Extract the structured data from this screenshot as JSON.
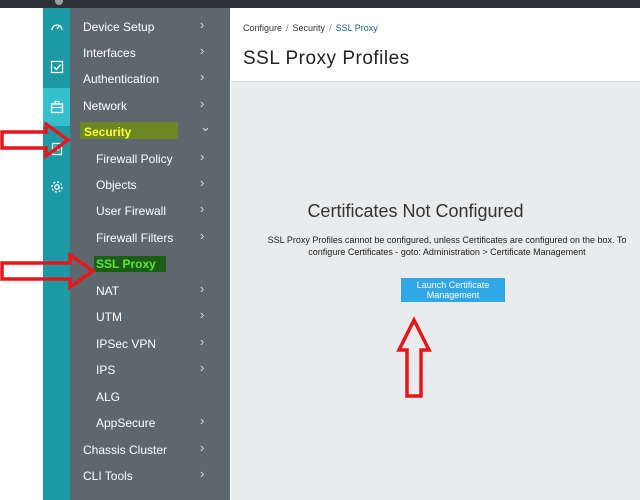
{
  "rail": {
    "icons": [
      "dashboard-icon",
      "monitor-icon",
      "configure-icon",
      "reports-icon",
      "settings-icon"
    ]
  },
  "nav": {
    "items": [
      {
        "label": "Device Setup",
        "chevron": "›"
      },
      {
        "label": "Interfaces",
        "chevron": "›"
      },
      {
        "label": "Authentication",
        "chevron": "›"
      },
      {
        "label": "Network",
        "chevron": "›"
      },
      {
        "label": "Security",
        "chevron": "⌄"
      },
      {
        "label": "Firewall Policy",
        "chevron": "›"
      },
      {
        "label": "Objects",
        "chevron": "›"
      },
      {
        "label": "User Firewall",
        "chevron": "›"
      },
      {
        "label": "Firewall Filters",
        "chevron": "›"
      },
      {
        "label": "SSL Proxy",
        "chevron": ""
      },
      {
        "label": "NAT",
        "chevron": "›"
      },
      {
        "label": "UTM",
        "chevron": "›"
      },
      {
        "label": "IPSec VPN",
        "chevron": "›"
      },
      {
        "label": "IPS",
        "chevron": "›"
      },
      {
        "label": "ALG",
        "chevron": ""
      },
      {
        "label": "AppSecure",
        "chevron": "›"
      },
      {
        "label": "Chassis Cluster",
        "chevron": "›"
      },
      {
        "label": "CLI Tools",
        "chevron": "›"
      }
    ]
  },
  "breadcrumb": {
    "items": [
      "Configure",
      "Security",
      "SSL Proxy"
    ],
    "separator": "/"
  },
  "page": {
    "title": "SSL Proxy Profiles",
    "empty_title": "Certificates Not Configured",
    "empty_message": "SSL Proxy Profiles cannot be configured, unless Certificates are configured on the box. To configure Certificates - goto: Administration > Certificate Management",
    "launch_button": "Launch Certificate Management"
  },
  "colors": {
    "rail": "#1b9aa6",
    "nav": "#5c6770",
    "accent_button": "#32a7e6",
    "annotation_arrow": "#e8161b",
    "highlight_security": "#6b8a1d",
    "highlight_ssl": "#1c5d16"
  }
}
